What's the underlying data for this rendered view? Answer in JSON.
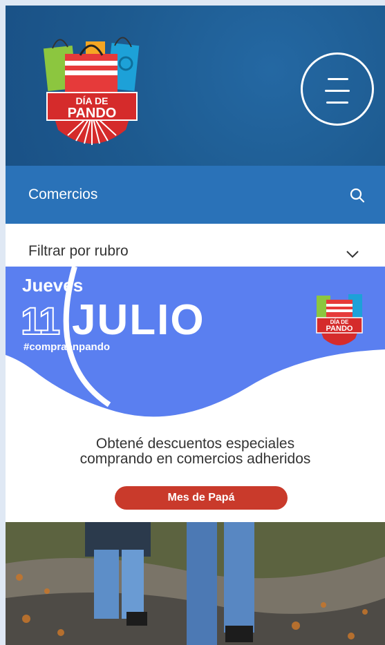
{
  "header": {
    "logo": {
      "line1": "DÍA DE",
      "line2": "PANDO"
    },
    "menu_icon": "hamburger-menu-icon"
  },
  "search": {
    "label": "Comercios",
    "icon": "search-icon"
  },
  "filter": {
    "label": "Filtrar por rubro",
    "icon": "chevron-down-icon"
  },
  "banner": {
    "weekday": "Jueves",
    "day": "11",
    "month": "JULIO",
    "hashtag": "#compraenpando",
    "description_line1": "Obtené descuentos especiales",
    "description_line2": "comprando en comercios adheridos",
    "cta_label": "Mes de Papá",
    "logo": {
      "line1": "DÍA DE",
      "line2": "PANDO"
    }
  },
  "colors": {
    "header_bg": "#1f5d93",
    "search_bg": "#2a72b8",
    "banner_blue": "#5a7ff0",
    "cta_red": "#c93a2b"
  }
}
